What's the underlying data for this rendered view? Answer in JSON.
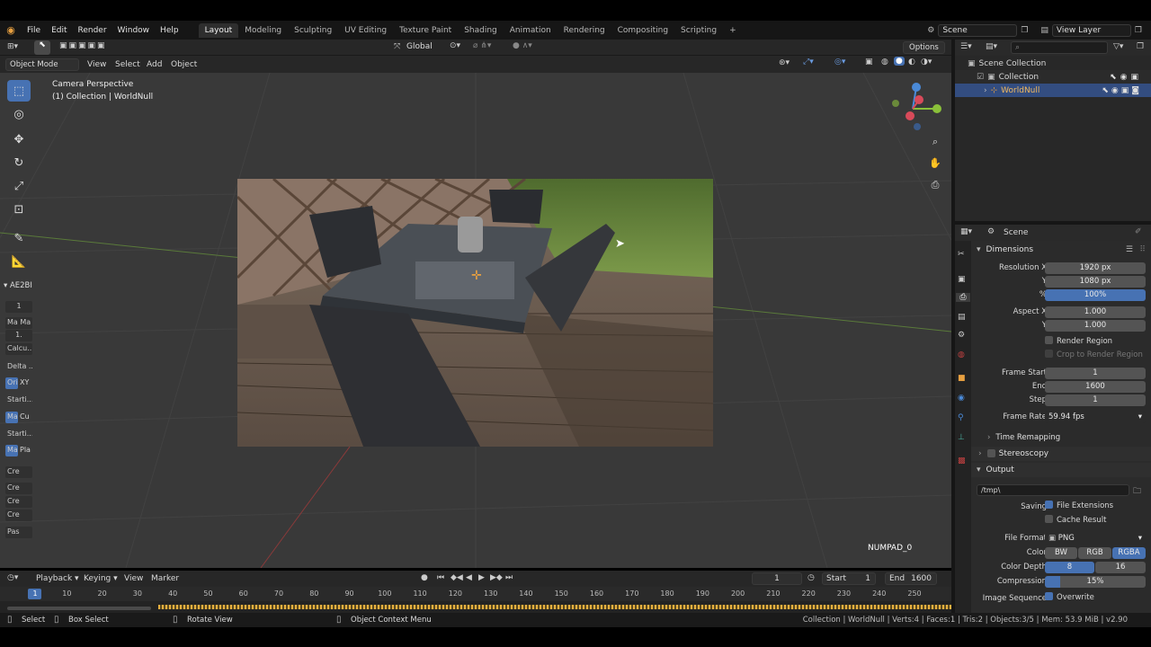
{
  "menu": {
    "file": "File",
    "edit": "Edit",
    "render": "Render",
    "window": "Window",
    "help": "Help"
  },
  "workspaces": [
    "Layout",
    "Modeling",
    "Sculpting",
    "UV Editing",
    "Texture Paint",
    "Shading",
    "Animation",
    "Rendering",
    "Compositing",
    "Scripting"
  ],
  "scene_name": "Scene",
  "view_layer": "View Layer",
  "viewport": {
    "mode": "Object Mode",
    "menus": [
      "View",
      "Select",
      "Add",
      "Object"
    ],
    "orientation": "Global",
    "options": "Options",
    "overlay_title": "Camera Perspective",
    "overlay_sub": "(1) Collection | WorldNull",
    "keyhint": "NUMPAD_0"
  },
  "npanel": {
    "tab": "AE2BI",
    "items": [
      "1",
      "Ma Ma",
      "1.",
      "Calcu...",
      "Delta ...",
      "Ori",
      "XY",
      "Starti...",
      "Ma",
      "Cu",
      "Starti...",
      "Ma",
      "Pla",
      "Cre",
      "Cre",
      "Cre",
      "Cre",
      "Pas"
    ]
  },
  "outliner": {
    "scene_collection": "Scene Collection",
    "collection": "Collection",
    "object": "WorldNull"
  },
  "props": {
    "context": "Scene",
    "dimensions": "Dimensions",
    "res_x_label": "Resolution X",
    "res_x": "1920 px",
    "y_label": "Y",
    "res_y": "1080 px",
    "pct_label": "%",
    "pct": "100%",
    "aspect_x_label": "Aspect X",
    "aspect_x": "1.000",
    "aspect_y": "1.000",
    "render_region": "Render Region",
    "crop": "Crop to Render Region",
    "frame_start_label": "Frame Start",
    "frame_start": "1",
    "end_label": "End",
    "frame_end": "1600",
    "step_label": "Step",
    "step": "1",
    "frame_rate_label": "Frame Rate",
    "frame_rate": "59.94 fps",
    "time_remap": "Time Remapping",
    "stereoscopy": "Stereoscopy",
    "output": "Output",
    "path": "/tmp\\",
    "saving_label": "Saving",
    "file_ext": "File Extensions",
    "cache": "Cache Result",
    "format_label": "File Format",
    "format": "PNG",
    "color_label": "Color",
    "bw": "BW",
    "rgb": "RGB",
    "rgba": "RGBA",
    "depth_label": "Color Depth",
    "d8": "8",
    "d16": "16",
    "compression_label": "Compression",
    "compression": "15%",
    "imgseq_label": "Image Sequence",
    "overwrite": "Overwrite"
  },
  "timeline": {
    "menus": [
      "Playback",
      "Keying",
      "View",
      "Marker"
    ],
    "current": "1",
    "start_label": "Start",
    "start": "1",
    "end_label": "End",
    "end": "1600",
    "ticks": [
      "1",
      "10",
      "20",
      "30",
      "40",
      "50",
      "60",
      "70",
      "80",
      "90",
      "100",
      "110",
      "120",
      "130",
      "140",
      "150",
      "160",
      "170",
      "180",
      "190",
      "200",
      "210",
      "220",
      "230",
      "240",
      "250"
    ]
  },
  "status": {
    "select": "Select",
    "box": "Box Select",
    "rotate": "Rotate View",
    "context": "Object Context Menu",
    "info": "Collection | WorldNull | Verts:4 | Faces:1 | Tris:2 | Objects:3/5 | Mem: 53.9 MiB | v2.90"
  }
}
